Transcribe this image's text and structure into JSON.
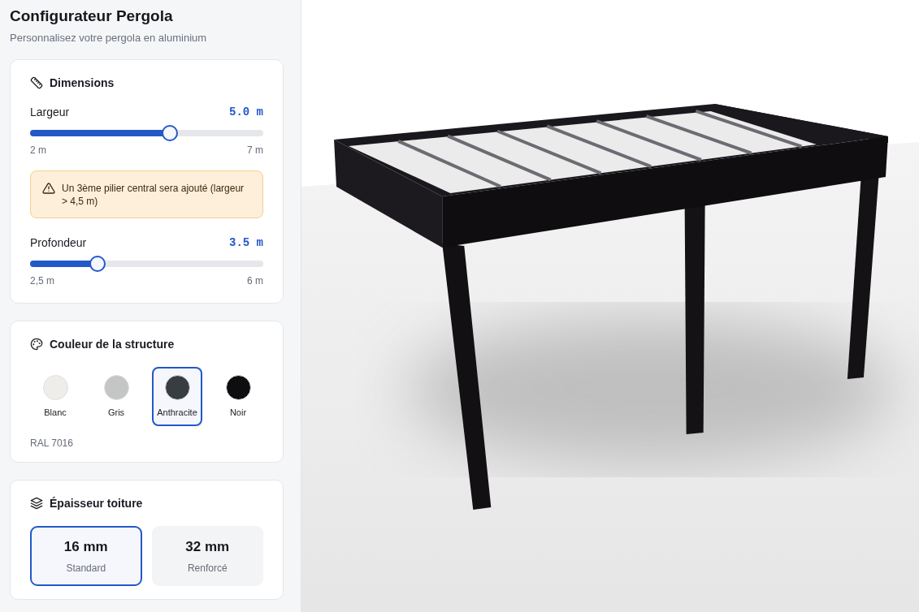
{
  "header": {
    "title": "Configurateur Pergola",
    "subtitle": "Personnalisez votre pergola en aluminium"
  },
  "dimensions": {
    "title": "Dimensions",
    "sliders": [
      {
        "label": "Largeur",
        "reading": "5.0 m",
        "level": 0.6,
        "min": "2 m",
        "max": "7 m"
      },
      {
        "label": "Profondeur",
        "reading": "3.5 m",
        "level": 0.29,
        "min": "2,5 m",
        "max": "6 m"
      }
    ],
    "warning": "Un 3ème pilier central sera ajouté (largeur > 4,5 m)"
  },
  "color": {
    "title": "Couleur de la structure",
    "swatches": [
      {
        "label": "Blanc",
        "color": "#eeede9",
        "selected": false
      },
      {
        "label": "Gris",
        "color": "#c4c6c5",
        "selected": false
      },
      {
        "label": "Anthracite",
        "color": "#383d42",
        "selected": true
      },
      {
        "label": "Noir",
        "color": "#0e0d10",
        "selected": false
      }
    ],
    "code": "RAL 7016"
  },
  "thickness": {
    "title": "Épaisseur toiture",
    "options": [
      {
        "value": "16 mm",
        "label": "Standard",
        "selected": true
      },
      {
        "value": "32 mm",
        "label": "Renforcé",
        "selected": false
      }
    ]
  }
}
